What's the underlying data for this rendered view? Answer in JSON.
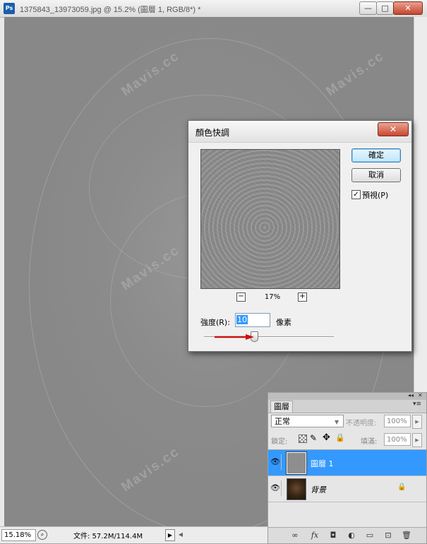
{
  "document": {
    "app_icon": "Ps",
    "title": "1375843_13973059.jpg @ 15.2% (圖層 1, RGB/8*) *",
    "window_buttons": {
      "minimize": "—",
      "maximize": "□",
      "close": "✕"
    },
    "watermark": "Mavis.cc"
  },
  "statusbar": {
    "zoom": "15.18%",
    "file_info": "文件: 57.2M/114.4M",
    "arrow": "▶",
    "scroll_left": "◀"
  },
  "dialog": {
    "title": "顏色快調",
    "close": "✕",
    "ok": "確定",
    "cancel": "取消",
    "preview_checked": "✓",
    "preview_label": "預視(P)",
    "zoom_out": "−",
    "zoom_in": "+",
    "preview_zoom": "17%",
    "radius_label": "強度(R):",
    "radius_value": "10",
    "radius_unit": "像素",
    "slider_fraction": 0.39
  },
  "layers_panel": {
    "collapse": "◂◂",
    "close": "✕",
    "tab": "圖層",
    "menu": "▾≡",
    "blend_mode": "正常",
    "blend_arrow": "▼",
    "opacity_label": "不透明度:",
    "opacity": "100%",
    "lock_label": "鎖定:",
    "lock_paint": "✎",
    "lock_move": "✥",
    "lock_all": "🔒",
    "fill_label": "填滿:",
    "fill": "100%",
    "small_arrow": "▶",
    "layers": [
      {
        "name": "圖層 1",
        "visible_icon": "👁"
      },
      {
        "name": "背景",
        "visible_icon": "👁",
        "lock_icon": "🔒"
      }
    ],
    "footer_icons": [
      "∞",
      "fx",
      "◘",
      "◐",
      "▭",
      "⊡",
      "🗑"
    ]
  },
  "colors": {
    "selection": "#3399ff",
    "ok_border": "#3c7fb1",
    "close_red": "#c5472e",
    "arrow_red": "#cc1111"
  }
}
